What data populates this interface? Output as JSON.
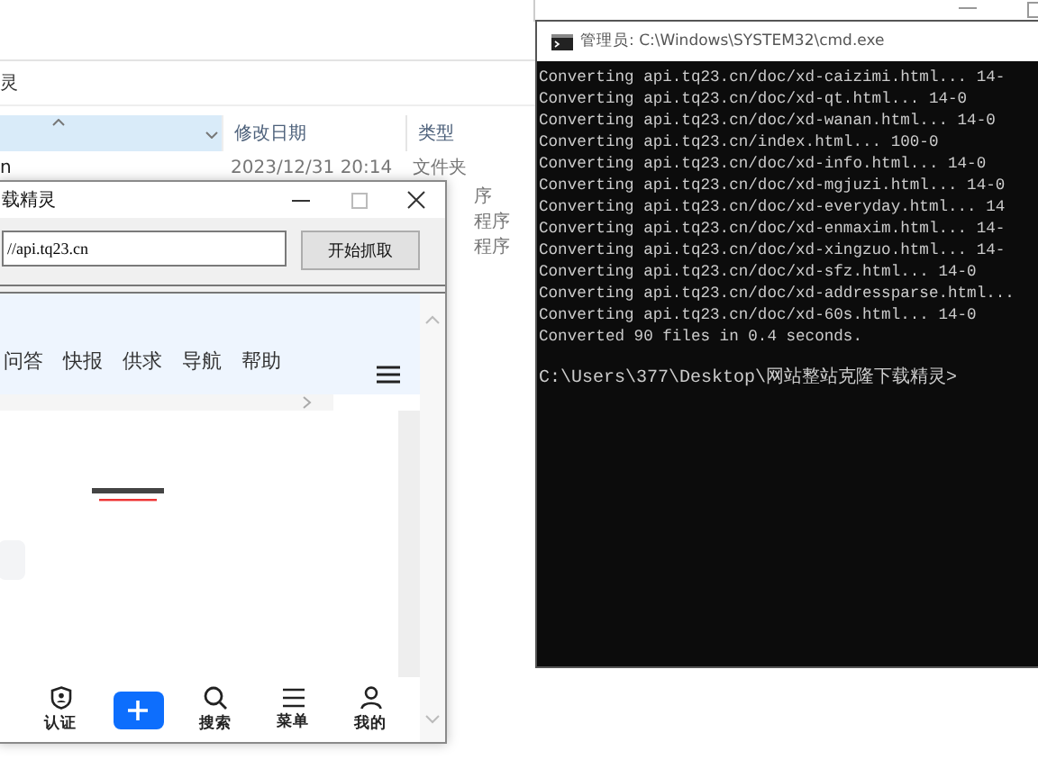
{
  "explorer": {
    "breadcrumb": "灵",
    "columns": [
      {
        "kind": "name",
        "selected": true
      },
      {
        "kind": "date",
        "label": "修改日期",
        "selected": false
      },
      {
        "kind": "type",
        "label": "类型",
        "selected": false
      }
    ],
    "rows": [
      {
        "name": "n",
        "modified": "2023/12/31 20:14",
        "type": "文件夹"
      },
      {
        "type": "序"
      },
      {
        "type": "程序"
      },
      {
        "type": "程序"
      }
    ]
  },
  "app": {
    "title": "载精灵",
    "url": "//api.tq23.cn",
    "start_button": "开始抓取",
    "nav": [
      "问答",
      "快报",
      "供求",
      "导航",
      "帮助"
    ],
    "bottom_nav": [
      {
        "kind": "shield",
        "label": "认证"
      },
      {
        "kind": "add"
      },
      {
        "kind": "search",
        "label": "搜索"
      },
      {
        "kind": "menu",
        "label": "菜单"
      },
      {
        "kind": "user",
        "label": "我的"
      }
    ]
  },
  "cmd": {
    "title": "管理员: C:\\Windows\\SYSTEM32\\cmd.exe",
    "lines": [
      "Converting api.tq23.cn/doc/xd-caizimi.html... 14-",
      "Converting api.tq23.cn/doc/xd-qt.html... 14-0",
      "Converting api.tq23.cn/doc/xd-wanan.html... 14-0",
      "Converting api.tq23.cn/index.html... 100-0",
      "Converting api.tq23.cn/doc/xd-info.html... 14-0",
      "Converting api.tq23.cn/doc/xd-mgjuzi.html... 14-0",
      "Converting api.tq23.cn/doc/xd-everyday.html... 14",
      "Converting api.tq23.cn/doc/xd-enmaxim.html... 14-",
      "Converting api.tq23.cn/doc/xd-xingzuo.html... 14-",
      "Converting api.tq23.cn/doc/xd-sfz.html... 14-0",
      "Converting api.tq23.cn/doc/xd-addressparse.html...",
      "Converting api.tq23.cn/doc/xd-60s.html... 14-0",
      "Converted 90 files in 0.4 seconds."
    ],
    "prompt": "C:\\Users\\377\\Desktop\\网站整站克隆下载精灵>"
  }
}
